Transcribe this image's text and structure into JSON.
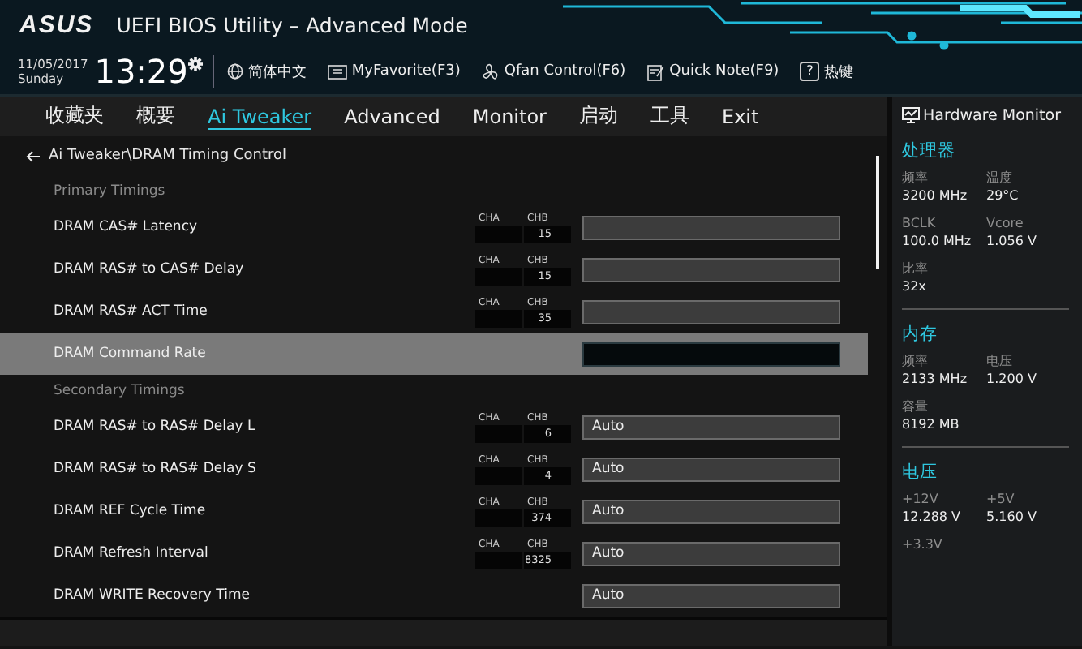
{
  "header": {
    "logo": "ASUS",
    "title": "UEFI BIOS Utility – Advanced Mode",
    "date": "11/05/2017",
    "day": "Sunday",
    "time": "13:29",
    "toolbar": [
      {
        "kind": "globe",
        "label": "简体中文"
      },
      {
        "kind": "favorite",
        "label": "MyFavorite(F3)"
      },
      {
        "kind": "fan",
        "label": "Qfan Control(F6)"
      },
      {
        "kind": "note",
        "label": "Quick Note(F9)"
      },
      {
        "kind": "help",
        "glyph": "?",
        "label": "热键"
      }
    ]
  },
  "tabs": [
    {
      "label": "收藏夹",
      "selected": false
    },
    {
      "label": "概要",
      "selected": false
    },
    {
      "label": "Ai Tweaker",
      "selected": true
    },
    {
      "label": "Advanced",
      "selected": false
    },
    {
      "label": "Monitor",
      "selected": false
    },
    {
      "label": "启动",
      "selected": false
    },
    {
      "label": "工具",
      "selected": false
    },
    {
      "label": "Exit",
      "selected": false
    }
  ],
  "breadcrumb": "Ai Tweaker\\DRAM Timing Control",
  "settings": [
    {
      "kind": "section",
      "label": "Primary Timings"
    },
    {
      "kind": "setting",
      "label": "DRAM CAS# Latency",
      "cha_label": "CHA",
      "chb_label": "CHB",
      "chb": "15",
      "selected": false
    },
    {
      "kind": "setting",
      "label": "DRAM RAS# to CAS# Delay",
      "cha_label": "CHA",
      "chb_label": "CHB",
      "chb": "15",
      "selected": false
    },
    {
      "kind": "setting",
      "label": "DRAM RAS# ACT Time",
      "cha_label": "CHA",
      "chb_label": "CHB",
      "chb": "35",
      "selected": false
    },
    {
      "kind": "setting",
      "label": "DRAM Command Rate",
      "selected": true
    },
    {
      "kind": "section",
      "label": "Secondary Timings"
    },
    {
      "kind": "setting",
      "label": "DRAM RAS# to RAS# Delay L",
      "cha_label": "CHA",
      "chb_label": "CHB",
      "chb": "6",
      "value": "Auto",
      "selected": false
    },
    {
      "kind": "setting",
      "label": "DRAM RAS# to RAS# Delay S",
      "cha_label": "CHA",
      "chb_label": "CHB",
      "chb": "4",
      "value": "Auto",
      "selected": false
    },
    {
      "kind": "setting",
      "label": "DRAM REF Cycle Time",
      "cha_label": "CHA",
      "chb_label": "CHB",
      "chb": "374",
      "value": "Auto",
      "selected": false
    },
    {
      "kind": "setting",
      "label": "DRAM Refresh Interval",
      "cha_label": "CHA",
      "chb_label": "CHB",
      "chb": "8325",
      "value": "Auto",
      "selected": false
    },
    {
      "kind": "setting",
      "label": "DRAM WRITE Recovery Time",
      "value": "Auto",
      "selected": false
    }
  ],
  "hardware_monitor": {
    "title": "Hardware Monitor",
    "sections": [
      {
        "title": "处理器",
        "items": [
          {
            "label": "频率",
            "value": "3200 MHz"
          },
          {
            "label": "温度",
            "value": "29°C"
          },
          {
            "label": "BCLK",
            "value": "100.0 MHz"
          },
          {
            "label": "Vcore",
            "value": "1.056 V"
          },
          {
            "label": "比率",
            "value": "32x"
          }
        ]
      },
      {
        "title": "内存",
        "items": [
          {
            "label": "频率",
            "value": "2133 MHz"
          },
          {
            "label": "电压",
            "value": "1.200 V"
          },
          {
            "label": "容量",
            "value": "8192 MB"
          }
        ]
      },
      {
        "title": "电压",
        "items": [
          {
            "label": "+12V",
            "value": "12.288 V"
          },
          {
            "label": "+5V",
            "value": "5.160 V"
          },
          {
            "label": "+3.3V"
          }
        ]
      }
    ]
  }
}
